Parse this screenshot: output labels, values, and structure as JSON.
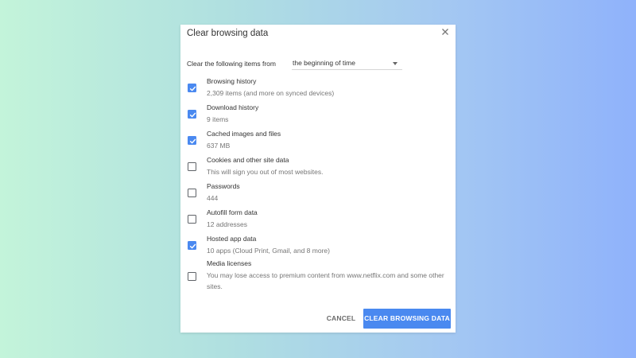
{
  "dialog": {
    "title": "Clear browsing data",
    "close_icon": "close-icon"
  },
  "time_range": {
    "label": "Clear the following items from",
    "selected": "the beginning of time"
  },
  "items": [
    {
      "label": "Browsing history",
      "desc": "2,309 items (and more on synced devices)",
      "checked": true
    },
    {
      "label": "Download history",
      "desc": "9 items",
      "checked": true
    },
    {
      "label": "Cached images and files",
      "desc": "637 MB",
      "checked": true
    },
    {
      "label": "Cookies and other site data",
      "desc": "This will sign you out of most websites.",
      "checked": false
    },
    {
      "label": "Passwords",
      "desc": "444",
      "checked": false
    },
    {
      "label": "Autofill form data",
      "desc": "12 addresses",
      "checked": false
    },
    {
      "label": "Hosted app data",
      "desc": "10 apps (Cloud Print, Gmail, and 8 more)",
      "checked": true
    },
    {
      "label": "Media licenses",
      "desc": "You may lose access to premium content from www.netflix.com and some other sites.",
      "checked": false
    }
  ],
  "buttons": {
    "cancel": "CANCEL",
    "clear": "CLEAR BROWSING DATA"
  },
  "colors": {
    "accent": "#4a89f0",
    "checkbox_off_border": "#5f6368"
  }
}
